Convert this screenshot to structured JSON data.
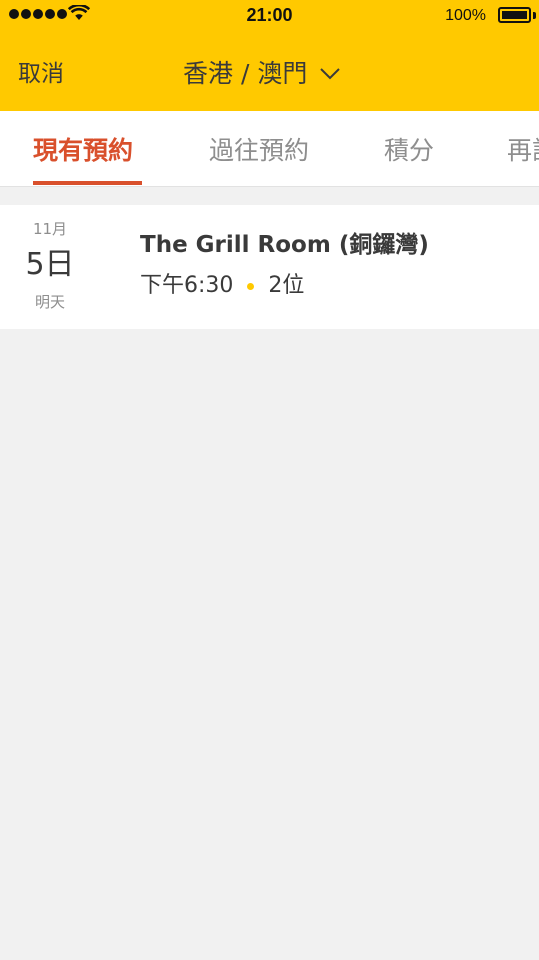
{
  "status_bar": {
    "time": "21:00",
    "battery_percent": "100%",
    "battery_level": 1.0
  },
  "header": {
    "cancel_label": "取消",
    "region_label": "香港 / 澳門",
    "region_icon": "chevron-down-icon",
    "background_color": "#ffc900"
  },
  "tabs": [
    {
      "label": "現有預約",
      "active": true
    },
    {
      "label": "過往預約",
      "active": false
    },
    {
      "label": "積分",
      "active": false
    },
    {
      "label": "再訂",
      "active": false
    }
  ],
  "accent_color": "#d9502c",
  "bookings": [
    {
      "month": "11月",
      "day": "5日",
      "relative_day": "明天",
      "restaurant": "The Grill Room (銅鑼灣)",
      "time": "下午6:30",
      "party_size": "2位",
      "separator_color": "#ffc900"
    }
  ]
}
